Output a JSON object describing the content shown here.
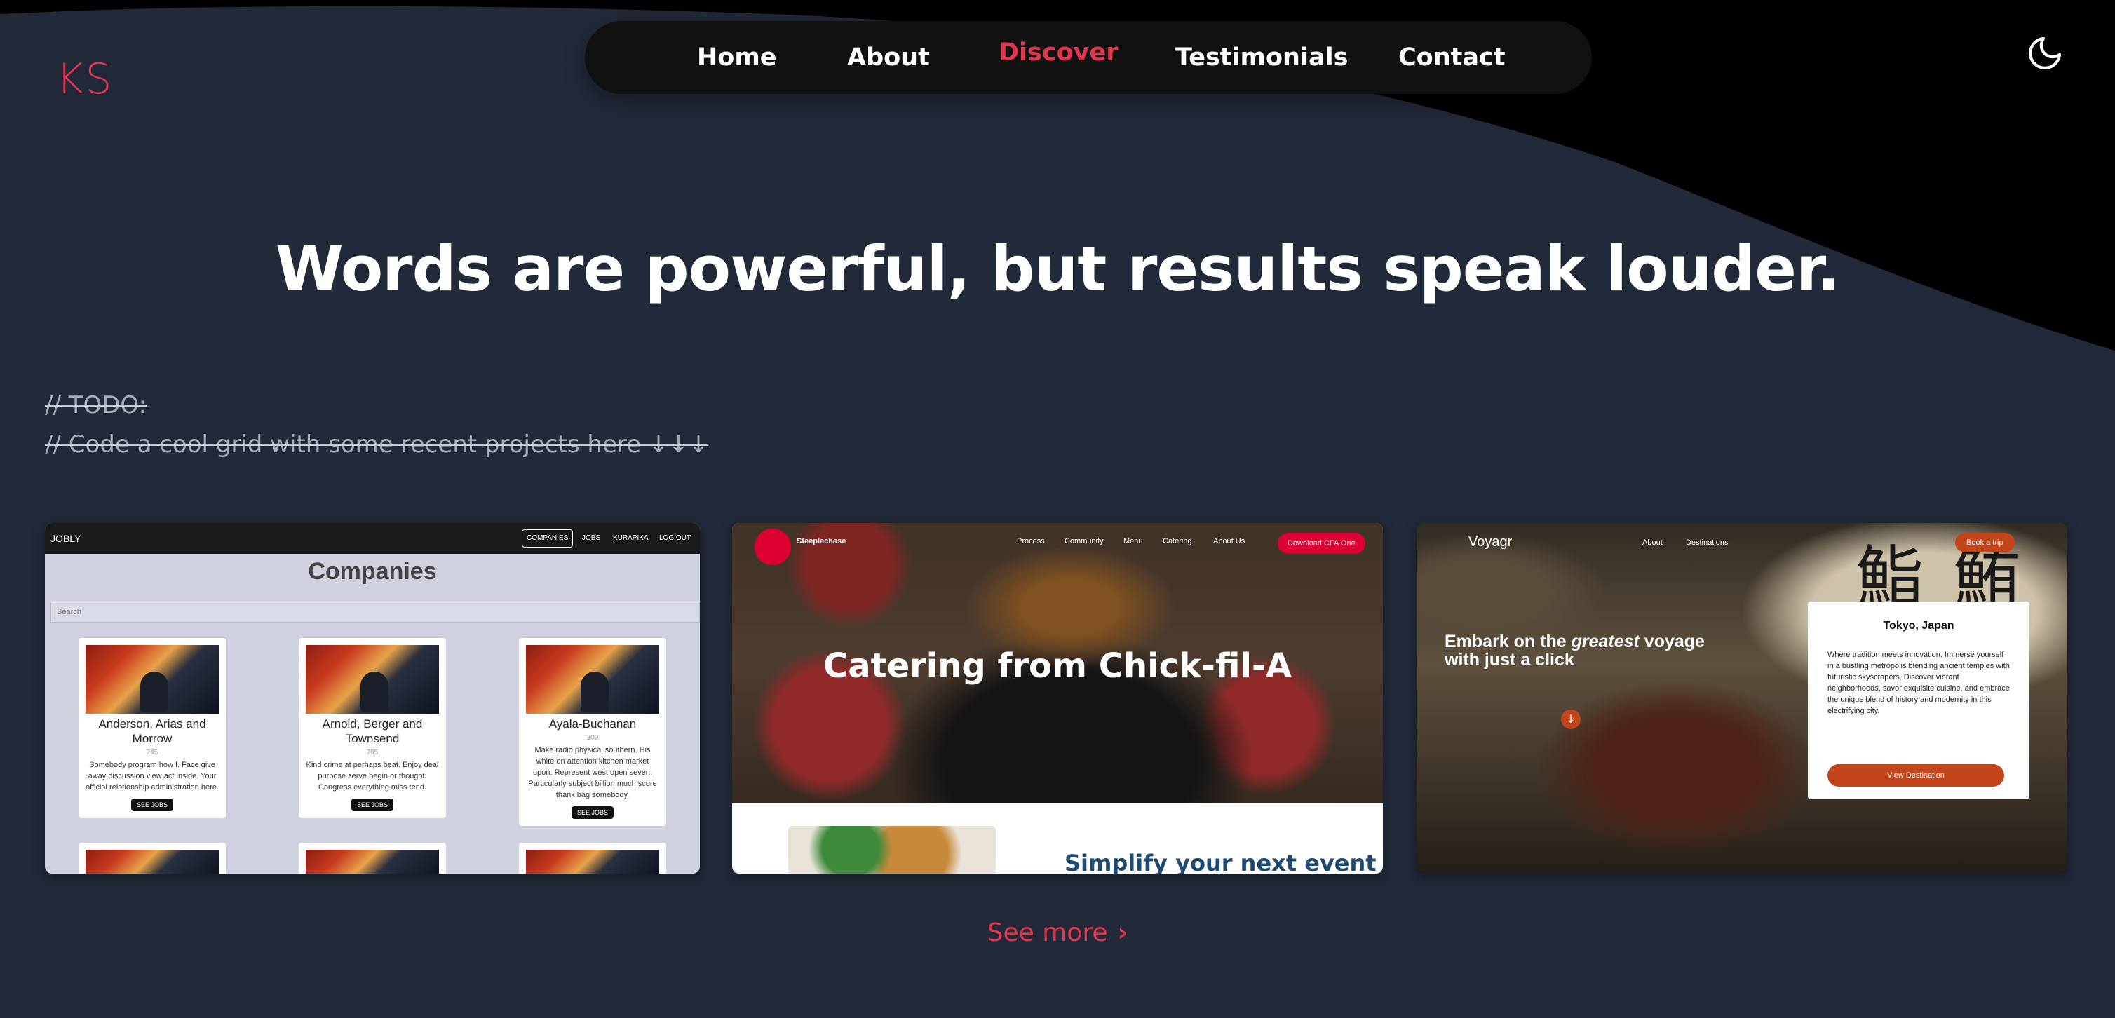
{
  "header": {
    "logo": "KS",
    "nav": [
      {
        "label": "Home"
      },
      {
        "label": "About"
      },
      {
        "label": "Discover",
        "active": true
      },
      {
        "label": "Testimonials"
      },
      {
        "label": "Contact"
      }
    ],
    "theme_toggle_icon": "moon-icon"
  },
  "hero": {
    "headline": "Words are powerful, but results speak louder."
  },
  "todo": {
    "line1": "// TODO:",
    "line2": "// Code a cool grid with some recent projects here ↓↓↓"
  },
  "projects": {
    "jobly": {
      "brand": "JOBLY",
      "nav": [
        "COMPANIES",
        "JOBS",
        "KURAPIKA",
        "LOG OUT"
      ],
      "title": "Companies",
      "search_placeholder": "Search",
      "companies": [
        {
          "name": "Anderson, Arias and Morrow",
          "count": "245",
          "desc": "Somebody program how I. Face give away discussion view act inside. Your official relationship administration here.",
          "button": "SEE JOBS"
        },
        {
          "name": "Arnold, Berger and Townsend",
          "count": "795",
          "desc": "Kind crime at perhaps beat. Enjoy deal purpose serve begin or thought. Congress everything miss tend.",
          "button": "SEE JOBS"
        },
        {
          "name": "Ayala-Buchanan",
          "count": "309",
          "desc": "Make radio physical southern. His white on attention kitchen market upon. Represent west open seven. Particularly subject billion much score thank bag somebody.",
          "button": "SEE JOBS"
        }
      ]
    },
    "chickfila": {
      "brand": "Steeplechase",
      "nav": [
        "Process",
        "Community",
        "Menu",
        "Catering",
        "About Us"
      ],
      "cta": "Download CFA One",
      "hero": "Catering from Chick-fil-A",
      "subheading": "Simplify your next event"
    },
    "voyagr": {
      "brand": "Voyagr",
      "nav": [
        "About",
        "Destinations"
      ],
      "cta": "Book a trip",
      "tagline_pre": "Embark on the ",
      "tagline_em": "greatest",
      "tagline_post": " voyage with just a click",
      "popup_title": "Tokyo, Japan",
      "popup_desc": "Where tradition meets innovation. Immerse yourself in a bustling metropolis blending ancient temples with futuristic skyscrapers. Discover vibrant neighborhoods, savor exquisite cuisine, and embrace the unique blend of history and modernity in this electrifying city.",
      "popup_button": "View Destination",
      "sign_text": "鮨 鮪"
    }
  },
  "see_more": "See more",
  "colors": {
    "background": "#222938",
    "accent": "#e0364f",
    "nav_bg": "#111111"
  }
}
